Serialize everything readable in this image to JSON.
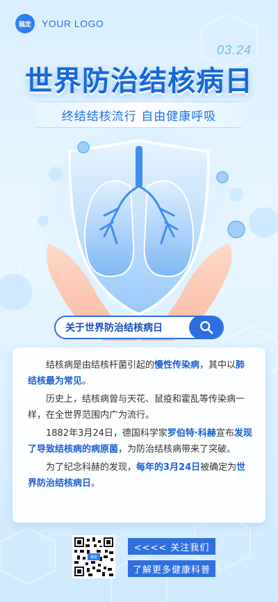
{
  "brand": {
    "badge": "稿定",
    "logo_text": "YOUR LOGO"
  },
  "date": "03.24",
  "title": "世界防治结核病日",
  "subtitle": "终结结核流行  自由健康呼吸",
  "search": {
    "label": "关于世界防治结核病日"
  },
  "article": {
    "p1_a": "结核病是由结核杆菌引起的",
    "p1_b": "慢性传染病",
    "p1_c": "，其中以",
    "p1_d": "肺结核最为常见",
    "p1_e": "。",
    "p2": "历史上，结核病曾与天花、鼠疫和霍乱等传染病一样，在全世界范围内广为流行。",
    "p3_a": "1882年3月24日，德国科学家",
    "p3_b": "罗伯特·科赫",
    "p3_c": "宣布",
    "p3_d": "发现了导致结核病的病原菌",
    "p3_e": "，为防治结核病带来了突破。",
    "p4_a": "为了纪念科赫的发现，",
    "p4_b": "每年的3月24日",
    "p4_c": "被确定为",
    "p4_d": "世界防治结核病日",
    "p4_e": "。"
  },
  "footer": {
    "qr_badge": "稿定",
    "follow": "<<<< 关注我们",
    "learn_more": "了解更多健康科普"
  },
  "colors": {
    "primary": "#2f6fe0",
    "title": "#1668d9",
    "highlight": "#1a5fd6"
  }
}
